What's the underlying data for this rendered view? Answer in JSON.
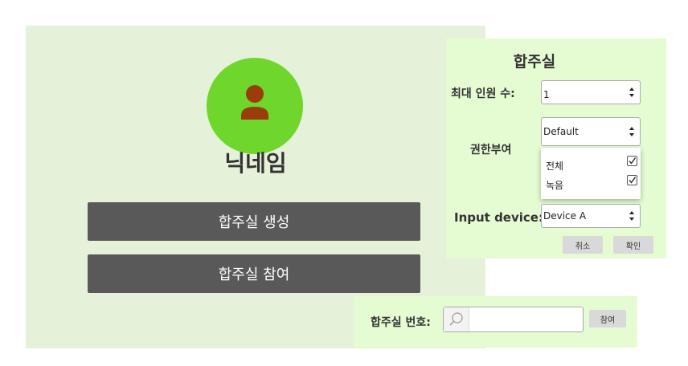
{
  "profile": {
    "nickname": "닉네임",
    "avatar_icon": "user-icon",
    "avatar_color": "#6fd62c",
    "person_color": "#9b3d0a"
  },
  "actions": {
    "create_room_label": "합주실 생성",
    "join_room_label": "합주실 참여"
  },
  "room_dialog": {
    "title": "합주실",
    "max_members_label": "최대 인원 수:",
    "max_members_value": "1",
    "permission_label": "권한부여",
    "permission_value": "Default",
    "permission_options": [
      {
        "label": "전체",
        "checked": true
      },
      {
        "label": "녹음",
        "checked": true
      }
    ],
    "input_device_label": "Input device:",
    "input_device_value": "Device A",
    "cancel_label": "취소",
    "confirm_label": "확인"
  },
  "join_bar": {
    "room_number_label": "합주실 번호:",
    "room_number_value": "",
    "join_label": "참여"
  },
  "colors": {
    "main_bg": "#e6f1d9",
    "dialog_bg": "#e5fbd2",
    "button_bg": "#595959"
  }
}
